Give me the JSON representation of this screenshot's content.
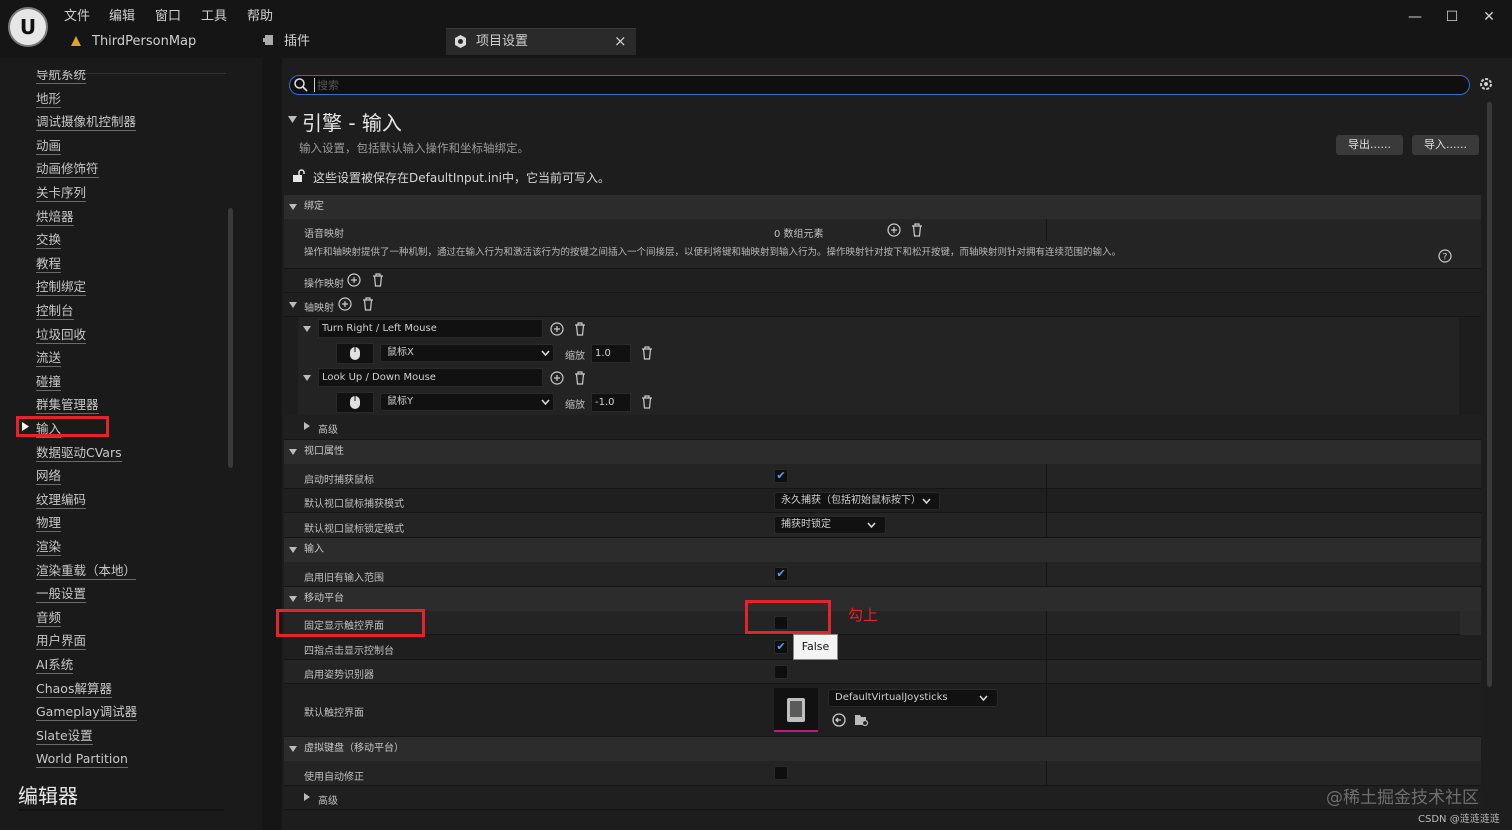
{
  "menu": [
    "文件",
    "编辑",
    "窗口",
    "工具",
    "帮助"
  ],
  "logo_icon": "unreal-logo-icon",
  "window_controls": [
    "—",
    "☐",
    "✕"
  ],
  "tabs": {
    "level": "ThirdPersonMap",
    "plugins": "插件",
    "settings": "项目设置",
    "close": "×"
  },
  "sidebar": {
    "items": [
      "导航系统",
      "地形",
      "调试摄像机控制器",
      "动画",
      "动画修饰符",
      "关卡序列",
      "烘焙器",
      "交换",
      "教程",
      "控制绑定",
      "控制台",
      "垃圾回收",
      "流送",
      "碰撞",
      "群集管理器",
      "输入",
      "数据驱动CVars",
      "网络",
      "纹理编码",
      "物理",
      "渲染",
      "渲染重载（本地）",
      "一般设置",
      "音频",
      "用户界面",
      "AI系统",
      "Chaos解算器",
      "Gameplay调试器",
      "Slate设置",
      "World Partition"
    ],
    "selected": "输入",
    "section_editor": "编辑器"
  },
  "search": {
    "placeholder": "搜索"
  },
  "header": {
    "title": "引擎 - 输入",
    "subtitle": "输入设置，包括默认输入操作和坐标轴绑定。",
    "config_note": "这些设置被保存在DefaultInput.ini中，它当前可写入。",
    "export": "导出......",
    "import": "导入......"
  },
  "bindings": {
    "section": "绑定",
    "speech_label": "语音映射",
    "speech_value": "0 数组元素",
    "description": "操作和轴映射提供了一种机制，通过在输入行为和激活该行为的按键之间插入一个间接层，以便利将键和轴映射到输入行为。操作映射针对按下和松开按键，而轴映射则针对拥有连续范围的输入。",
    "action_label": "操作映射",
    "axis_label": "轴映射",
    "axes": [
      {
        "name": "Turn Right / Left Mouse",
        "key": "鼠标X",
        "scale_label": "缩放",
        "scale": "1.0"
      },
      {
        "name": "Look Up / Down Mouse",
        "key": "鼠标Y",
        "scale_label": "缩放",
        "scale": "-1.0"
      }
    ],
    "advanced": "高级"
  },
  "viewport": {
    "section": "视口属性",
    "capture_label": "启动时捕获鼠标",
    "capture_checked": true,
    "capture_mode_label": "默认视口鼠标捕获模式",
    "capture_mode_value": "永久捕获（包括初始鼠标按下）",
    "lock_mode_label": "默认视口鼠标锁定模式",
    "lock_mode_value": "捕获时锁定"
  },
  "input": {
    "section": "输入",
    "legacy_label": "启用旧有输入范围",
    "legacy_checked": true
  },
  "mobile": {
    "section": "移动平台",
    "always_touch_label": "固定显示触控界面",
    "always_touch_checked": false,
    "tooltip": "False",
    "annotation": "勾上",
    "four_finger_label": "四指点击显示控制台",
    "four_finger_checked": true,
    "gesture_label": "启用姿势识别器",
    "gesture_checked": false,
    "default_touch_label": "默认触控界面",
    "default_touch_value": "DefaultVirtualJoysticks"
  },
  "vkeyboard": {
    "section": "虚拟键盘（移动平台）",
    "autocorrect_label": "使用自动修正",
    "advanced": "高级"
  },
  "watermark": "@稀土掘金技术社区",
  "watermark2": "CSDN @涟涟涟涟",
  "colors": {
    "accent": "#2f6ed1",
    "highlight_red": "#e4232b",
    "check_blue": "#4aa0ff"
  }
}
